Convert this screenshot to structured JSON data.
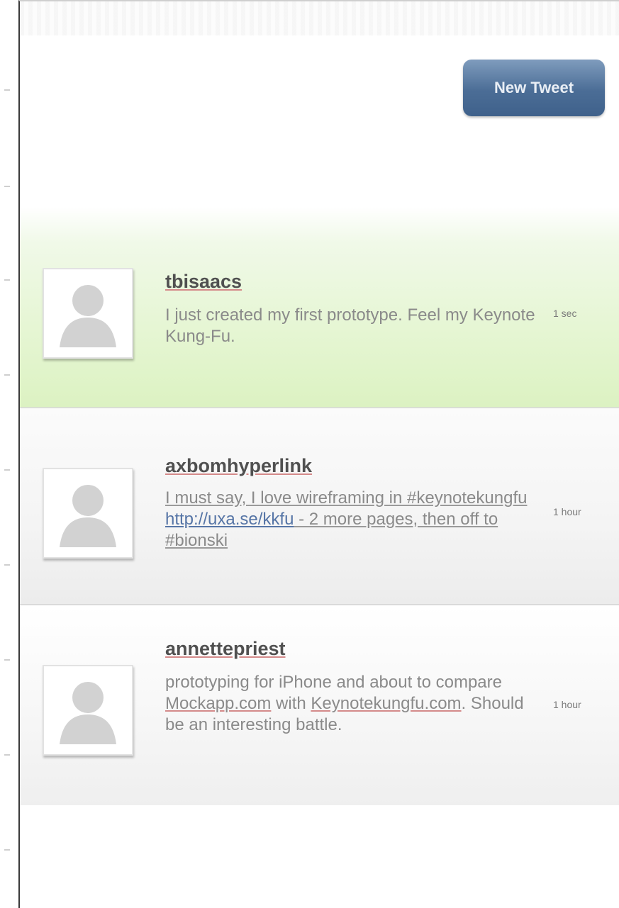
{
  "toolbar": {
    "new_tweet_label": "New Tweet"
  },
  "tweets": [
    {
      "username": "tbisaacs",
      "text": "I just created my first prototype. Feel my Keynote Kung-Fu.",
      "time": "1 sec"
    },
    {
      "username": "axbomhyperlink",
      "text_part1": "I must say, I love wireframing in #keynotekungfu ",
      "link": "http://uxa.se/kkfu",
      "text_part2": " - 2 more pages, then off to #bionski",
      "time": "1 hour"
    },
    {
      "username": "annettepriest",
      "text_part1": "prototyping for iPhone and about to compare ",
      "link1": "Mockapp.com",
      "text_part2": " with ",
      "link2": "Keynotekungfu.com",
      "text_part3": ". Should be an interesting battle.",
      "time": "1 hour"
    }
  ],
  "colors": {
    "button_top": "#7f9cbd",
    "button_bottom": "#3f618b",
    "highlight_green": "#dcf2c2",
    "link_blue": "#5675a6"
  }
}
